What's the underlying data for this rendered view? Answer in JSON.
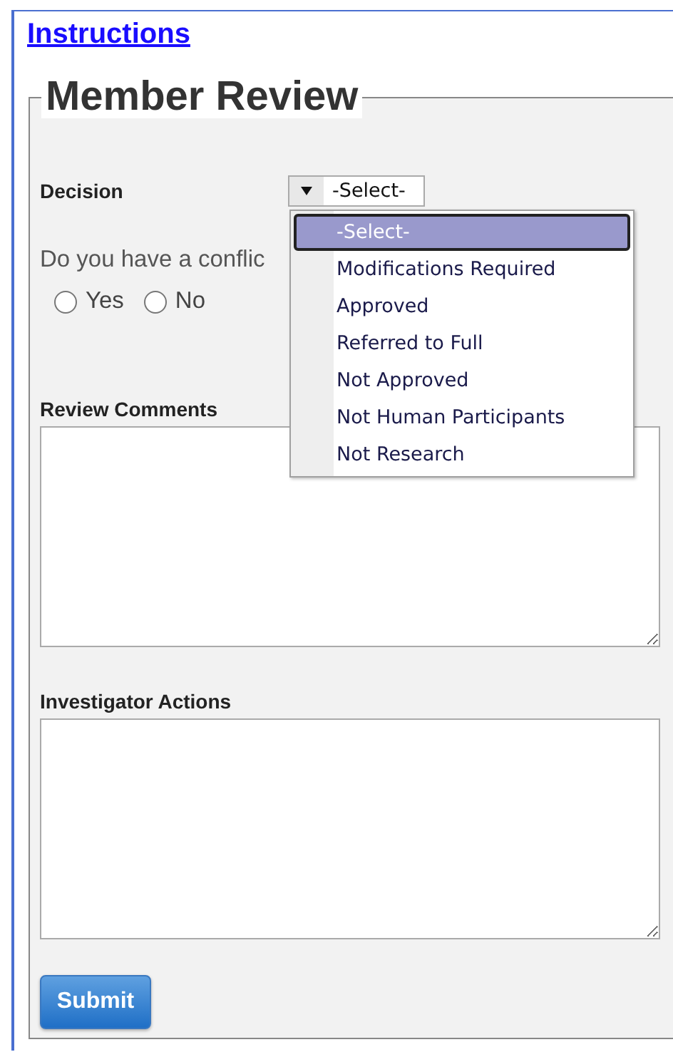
{
  "link": "Instructions",
  "form": {
    "legend": "Member Review",
    "decision": {
      "label": "Decision",
      "value": "-Select-",
      "expanded": true,
      "options": [
        {
          "label": "-Select-",
          "selected": true
        },
        {
          "label": "Modifications Required",
          "selected": false
        },
        {
          "label": "Approved",
          "selected": false
        },
        {
          "label": "Referred to Full",
          "selected": false
        },
        {
          "label": "Not Approved",
          "selected": false
        },
        {
          "label": "Not Human Participants",
          "selected": false
        },
        {
          "label": "Not Research",
          "selected": false
        }
      ]
    },
    "conflict": {
      "question": "Do you have a conflic",
      "options": [
        {
          "label": "Yes",
          "selected": false
        },
        {
          "label": "No",
          "selected": false
        }
      ]
    },
    "fields": [
      {
        "label": "Review Comments"
      },
      {
        "label": "Investigator Actions"
      }
    ],
    "submit": "Submit"
  }
}
